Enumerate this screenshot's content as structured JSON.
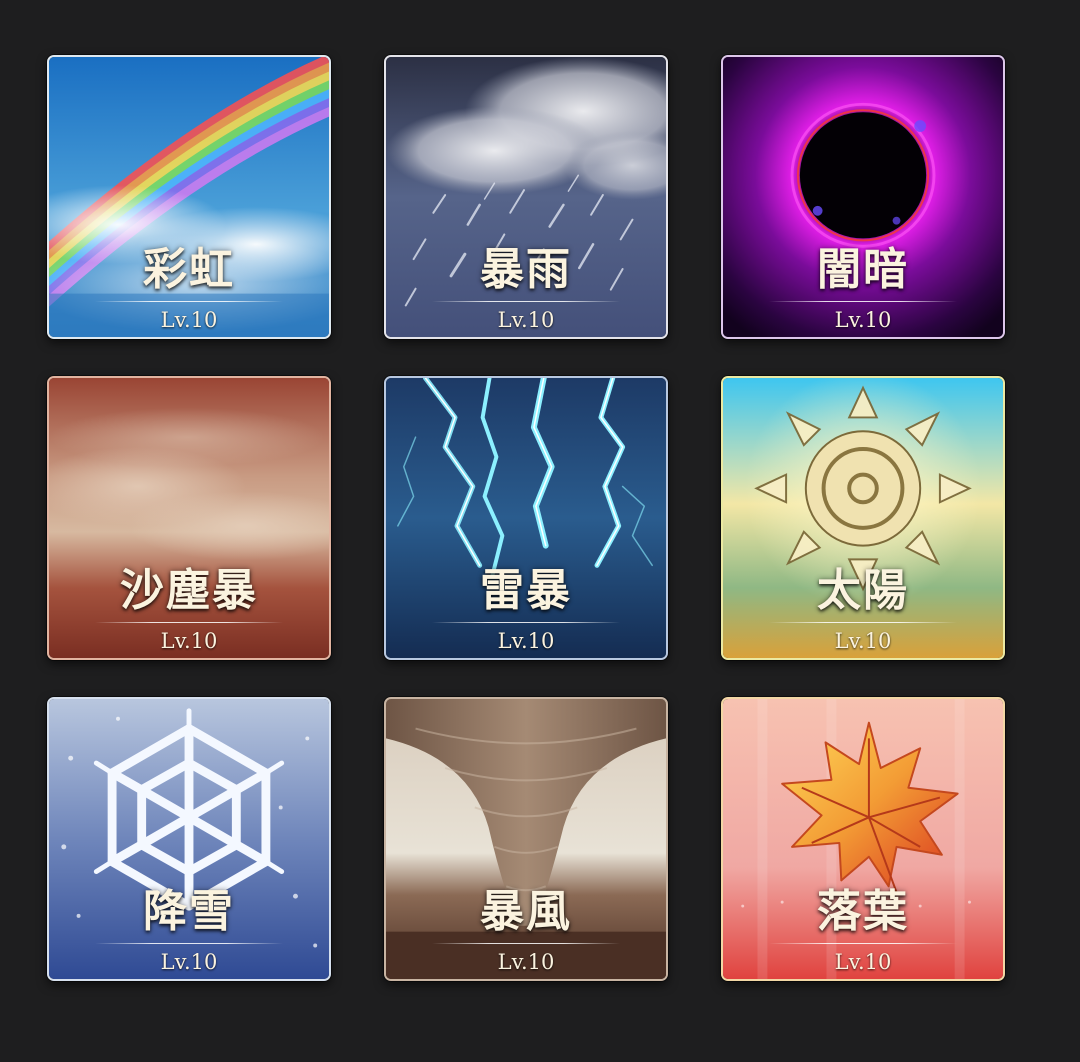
{
  "cards": [
    {
      "name": "彩虹",
      "level": "Lv.10",
      "icon": "rainbow-icon",
      "accent": "#2f7fc4"
    },
    {
      "name": "暴雨",
      "level": "Lv.10",
      "icon": "rain-cloud-icon",
      "accent": "#4f5f86"
    },
    {
      "name": "闇暗",
      "level": "Lv.10",
      "icon": "dark-vortex-icon",
      "accent": "#b21fd0"
    },
    {
      "name": "沙塵暴",
      "level": "Lv.10",
      "icon": "sandstorm-icon",
      "accent": "#a0503c"
    },
    {
      "name": "雷暴",
      "level": "Lv.10",
      "icon": "lightning-icon",
      "accent": "#1f4f86"
    },
    {
      "name": "太陽",
      "level": "Lv.10",
      "icon": "sun-icon",
      "accent": "#e8e07a"
    },
    {
      "name": "降雪",
      "level": "Lv.10",
      "icon": "snowflake-icon",
      "accent": "#4e6aa8"
    },
    {
      "name": "暴風",
      "level": "Lv.10",
      "icon": "tornado-icon",
      "accent": "#5b4032"
    },
    {
      "name": "落葉",
      "level": "Lv.10",
      "icon": "maple-leaf-icon",
      "accent": "#e5564a"
    }
  ]
}
